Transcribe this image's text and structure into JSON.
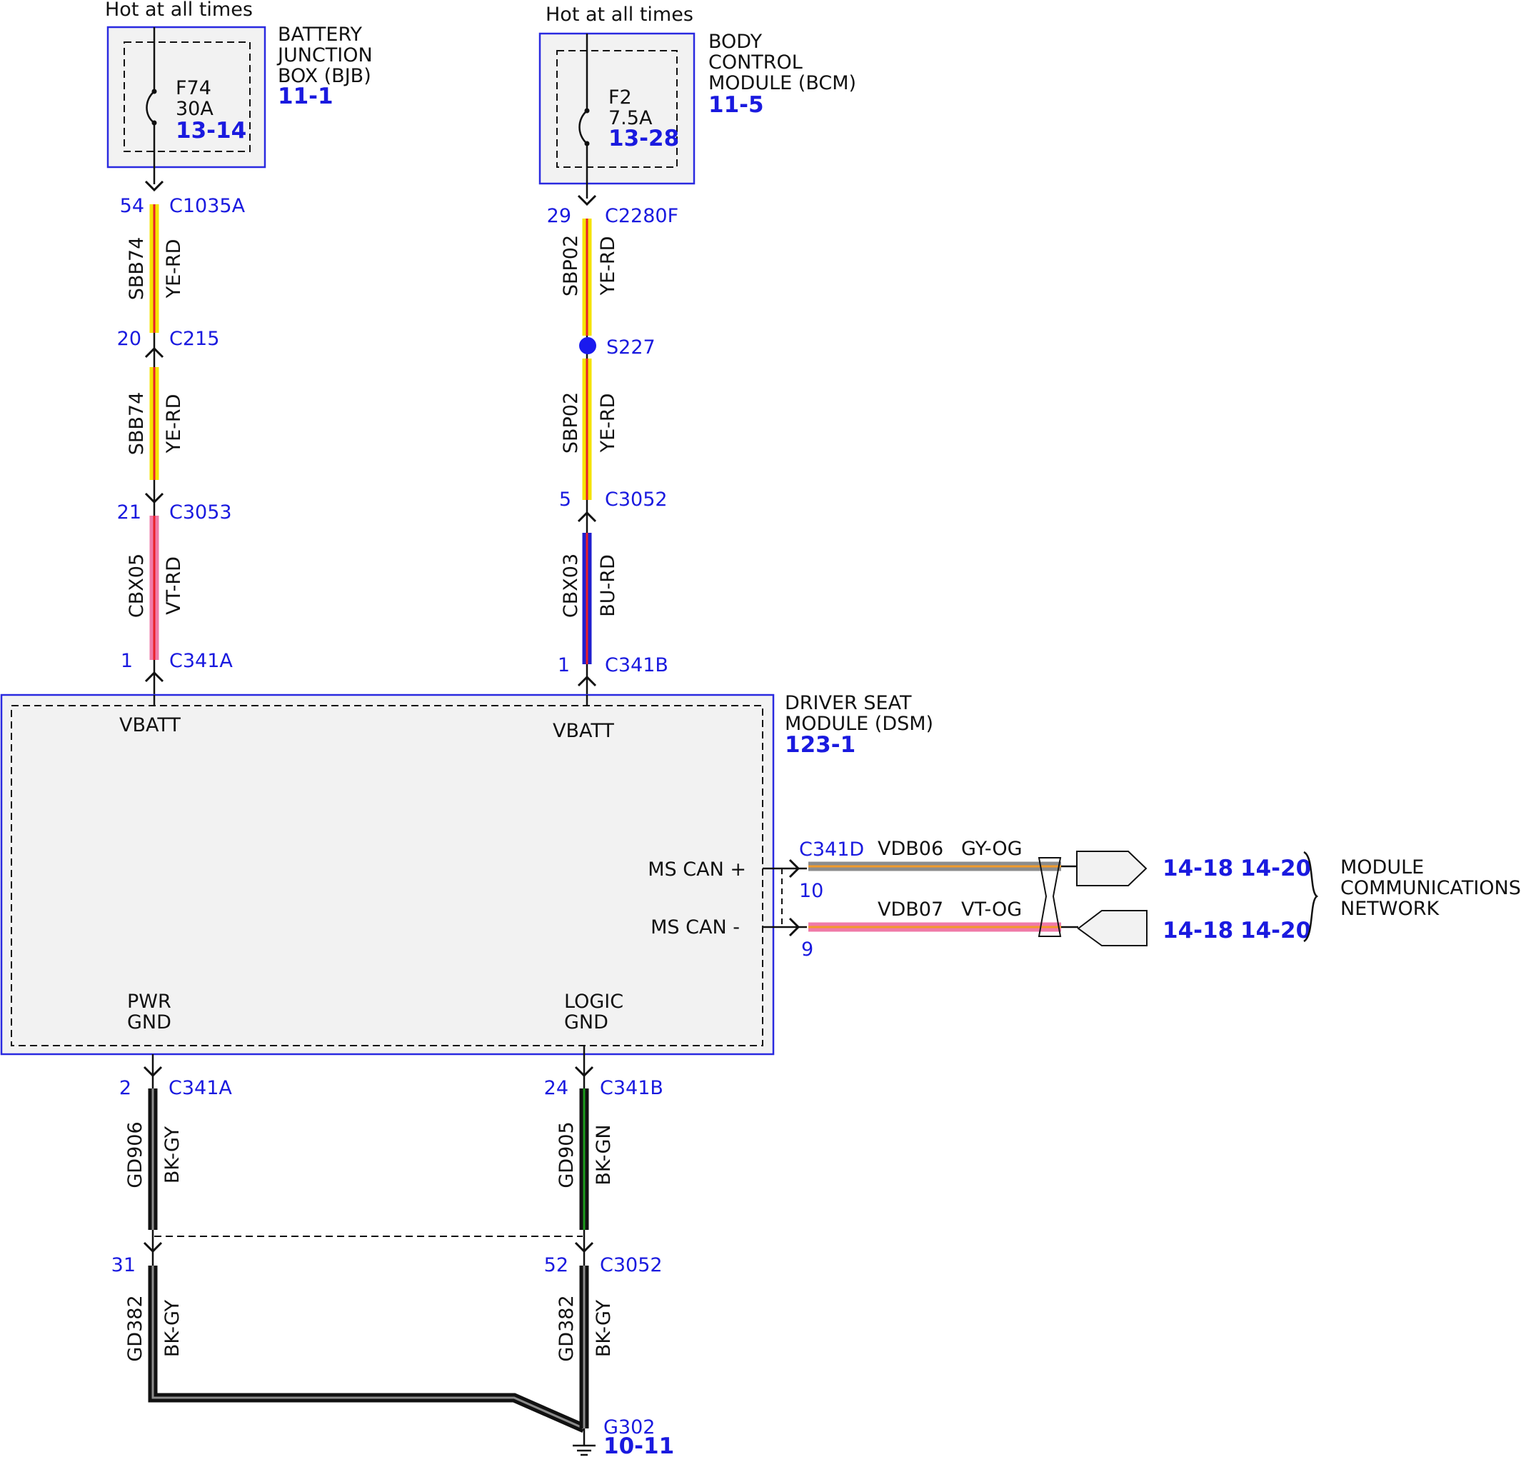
{
  "colors": {
    "module_border": "#2a2ae0",
    "module_fill": "#f2f2f2",
    "reference_blue": "#1a1adf",
    "wire_yellow": "#f5e400",
    "wire_red": "#e8202a",
    "wire_violet_pink": "#f07aa8",
    "wire_blue": "#2020d0",
    "wire_black": "#111111",
    "wire_green": "#1c9a1c",
    "wire_gray": "#8c8c8c",
    "wire_orange": "#f29a2a"
  },
  "bjb": {
    "hot_label": "Hot at all times",
    "name_lines": [
      "BATTERY",
      "JUNCTION",
      "BOX (BJB)"
    ],
    "ref": "11-1",
    "fuse": {
      "id": "F74",
      "rating": "30A",
      "ref": "13-14"
    }
  },
  "bcm": {
    "hot_label": "Hot at all times",
    "name_lines": [
      "BODY",
      "CONTROL",
      "MODULE (BCM)"
    ],
    "ref": "11-5",
    "fuse": {
      "id": "F2",
      "rating": "7.5A",
      "ref": "13-28"
    }
  },
  "left_circuit": {
    "c1": {
      "pin": "54",
      "connector": "C1035A"
    },
    "seg1": {
      "circuit": "SBB74",
      "color": "YE-RD"
    },
    "c2": {
      "pin": "20",
      "connector": "C215"
    },
    "seg2": {
      "circuit": "SBB74",
      "color": "YE-RD"
    },
    "c3": {
      "pin": "21",
      "connector": "C3053"
    },
    "seg3": {
      "circuit": "CBX05",
      "color": "VT-RD"
    },
    "c4": {
      "pin": "1",
      "connector": "C341A"
    }
  },
  "right_circuit": {
    "c1": {
      "pin": "29",
      "connector": "C2280F"
    },
    "seg1": {
      "circuit": "SBP02",
      "color": "YE-RD"
    },
    "splice": "S227",
    "seg2": {
      "circuit": "SBP02",
      "color": "YE-RD"
    },
    "c3": {
      "pin": "5",
      "connector": "C3052"
    },
    "seg3": {
      "circuit": "CBX03",
      "color": "BU-RD"
    },
    "c4": {
      "pin": "1",
      "connector": "C341B"
    }
  },
  "dsm": {
    "name_lines": [
      "DRIVER SEAT",
      "MODULE (DSM)"
    ],
    "ref": "123-1",
    "vbatt_left": "VBATT",
    "vbatt_right": "VBATT",
    "ms_can_plus": "MS CAN +",
    "ms_can_minus": "MS CAN -",
    "pwr_gnd": [
      "PWR",
      "GND"
    ],
    "logic_gnd": [
      "LOGIC",
      "GND"
    ]
  },
  "can": {
    "connector": "C341D",
    "plus": {
      "pin": "10",
      "circuit": "VDB06",
      "color": "GY-OG",
      "refs": [
        "14-18",
        "14-20"
      ]
    },
    "minus": {
      "pin": "9",
      "circuit": "VDB07",
      "color": "VT-OG",
      "refs": [
        "14-18",
        "14-20"
      ]
    },
    "network_lines": [
      "MODULE",
      "COMMUNICATIONS",
      "NETWORK"
    ]
  },
  "ground_left": {
    "c1": {
      "pin": "2",
      "connector": "C341A"
    },
    "seg1": {
      "circuit": "GD906",
      "color": "BK-GY"
    },
    "c2": {
      "pin": "31"
    },
    "seg2": {
      "circuit": "GD382",
      "color": "BK-GY"
    }
  },
  "ground_right": {
    "c1": {
      "pin": "24",
      "connector": "C341B"
    },
    "seg1": {
      "circuit": "GD905",
      "color": "BK-GN"
    },
    "c2": {
      "pin": "52",
      "connector": "C3052"
    },
    "seg2": {
      "circuit": "GD382",
      "color": "BK-GY"
    }
  },
  "ground_point": {
    "id": "G302",
    "ref": "10-11"
  }
}
